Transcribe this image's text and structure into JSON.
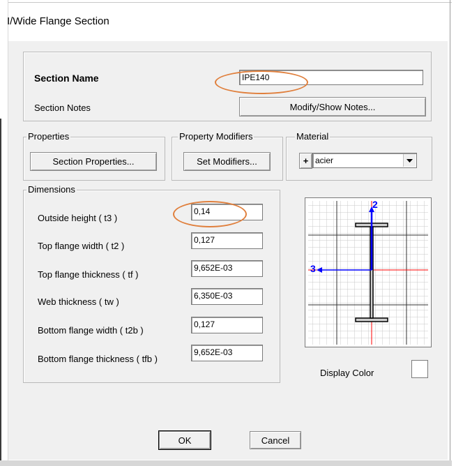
{
  "window": {
    "title": "I/Wide Flange Section"
  },
  "section": {
    "name_label": "Section Name",
    "name_value": "IPE140",
    "notes_label": "Section Notes",
    "notes_button": "Modify/Show Notes..."
  },
  "properties": {
    "legend": "Properties",
    "button": "Section Properties..."
  },
  "modifiers": {
    "legend": "Property Modifiers",
    "button": "Set Modifiers..."
  },
  "material": {
    "legend": "Material",
    "plus": "+",
    "selected": "acier"
  },
  "dimensions": {
    "legend": "Dimensions",
    "rows": [
      {
        "label": "Outside height  ( t3 )",
        "value": "0,14"
      },
      {
        "label": "Top flange width  ( t2 )",
        "value": "0,127"
      },
      {
        "label": "Top flange thickness  ( tf )",
        "value": "9,652E-03"
      },
      {
        "label": "Web thickness  ( tw )",
        "value": "6,350E-03"
      },
      {
        "label": "Bottom flange width  ( t2b )",
        "value": "0,127"
      },
      {
        "label": "Bottom flange thickness  ( tfb )",
        "value": "9,652E-03"
      }
    ]
  },
  "preview": {
    "axis2": "2",
    "axis3": "3",
    "axis_colors": {
      "vertical_axis": "#0000ff",
      "horizontal_axis": "#0000ff",
      "center_lines": "#ff0000",
      "section": "#000000"
    }
  },
  "display_color": {
    "label": "Display Color"
  },
  "buttons": {
    "ok": "OK",
    "cancel": "Cancel"
  },
  "annotations": {
    "highlight_color": "#e07f3c"
  }
}
